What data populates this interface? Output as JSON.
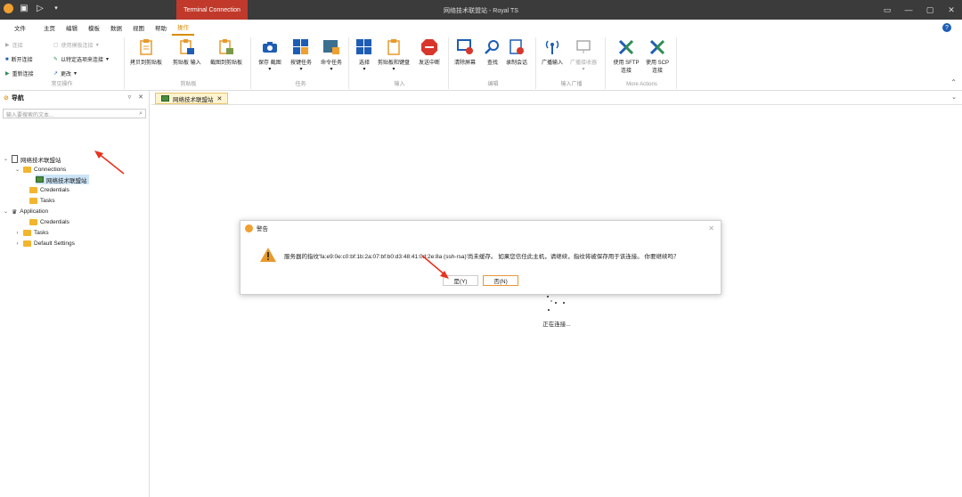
{
  "titlebar": {
    "title": "网络技术联盟站 - Royal TS",
    "context_tab": "Terminal Connection",
    "win_controls": [
      "▭",
      "—",
      "▢",
      "✕"
    ]
  },
  "menu": {
    "items": [
      "文件",
      "主页",
      "编辑",
      "模板",
      "数据",
      "视图",
      "帮助",
      "操作"
    ],
    "active": "操作",
    "help": "?"
  },
  "ribbon": {
    "common": {
      "connect": "连接",
      "use_template": "使用模板连接",
      "disconnect": "断开连接",
      "connect_options": "以特定选项来连接",
      "reconnect": "重新连接",
      "change": "更改",
      "label": "常见操作"
    },
    "clipboard": {
      "copy": "拷贝到剪贴板",
      "paste_input": "剪贴板 输入",
      "screenshot": "截图到剪贴板",
      "label": "剪贴板"
    },
    "tasks": {
      "save": "保存",
      "capture": "截图",
      "key_task": "按键任务",
      "cmd_task": "命令任务",
      "label": "任务"
    },
    "input": {
      "select": "选择",
      "clipboard_keyboard": "剪贴板和键盘",
      "send_interrupt": "发送中断",
      "label": "输入"
    },
    "edit": {
      "clear_screen": "清除屏幕",
      "find": "查找",
      "record": "录制会话",
      "label": "编辑"
    },
    "broadcast": {
      "broadcast_input": "广播输入",
      "broadcast_receiver": "广播接收器",
      "label": "输入广播"
    },
    "more": {
      "sftp": "使用 SFTP 连接",
      "scp": "使用 SCP 连接",
      "label": "More Actions"
    }
  },
  "nav": {
    "title": "导航",
    "search_placeholder": "输入要搜索的文本...",
    "tree": {
      "root": "网络技术联盟站",
      "connections": "Connections",
      "conn_item": "网络技术联盟站",
      "credentials": "Credentials",
      "tasks": "Tasks",
      "application": "Application",
      "app_credentials": "Credentials",
      "app_tasks": "Tasks",
      "default_settings": "Default Settings"
    }
  },
  "tab": {
    "label": "网络技术联盟站"
  },
  "content": {
    "status": "正在连接..."
  },
  "dialog": {
    "title": "警告",
    "message": "服务器的指纹'fa:e9:0e:c0:bf:1b:2a:07:bf:b0:d3:48:41:0d:2e:8a (ssh-rsa)'尚未缓存。 如果您信任此主机，请继续，指纹将被保存用于该连接。 你要继续吗？",
    "yes": "是(Y)",
    "no": "否(N)"
  },
  "colors": {
    "accent": "#d98c00",
    "context_red": "#c0392b",
    "folder": "#f2b52d",
    "arrow": "#e8321e"
  }
}
